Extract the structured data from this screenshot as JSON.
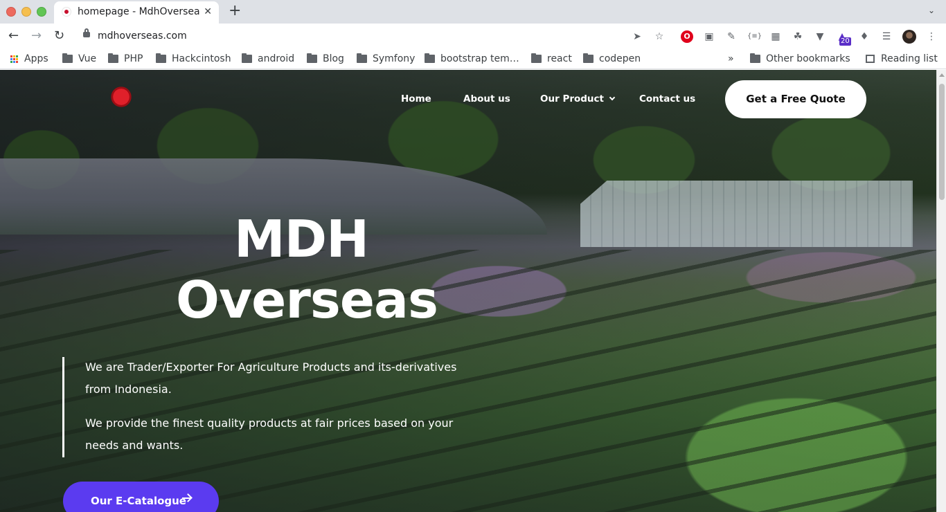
{
  "browser": {
    "tab_title": "homepage - MdhOverseas",
    "tab_close": "✕",
    "new_tab": "+",
    "url": "mdhoverseas.com",
    "extension_badge": "20",
    "bookmarks": [
      "Apps",
      "Vue",
      "PHP",
      "Hackcintosh",
      "android",
      "Blog",
      "Symfony",
      "bootstrap tem…",
      "react",
      "codepen"
    ],
    "bookmarks_overflow": "»",
    "other_bookmarks": "Other bookmarks",
    "reading_list": "Reading list"
  },
  "nav": {
    "home": "Home",
    "about": "About us",
    "product": "Our Product",
    "contact": "Contact us",
    "quote_button": "Get a Free Quote"
  },
  "hero": {
    "title_line1": "MDH",
    "title_line2": "Overseas",
    "paragraph1": "We are Trader/Exporter For Agriculture Products and its-derivatives from Indonesia.",
    "paragraph2": "We provide the finest quality products at fair prices based on your needs and wants.",
    "catalogue_button": "Our E-Catalogue"
  },
  "colors": {
    "accent": "#5b3bf0",
    "traffic_red": "#ed6a5e",
    "traffic_yellow": "#f5bf4f",
    "traffic_green": "#61c554"
  }
}
